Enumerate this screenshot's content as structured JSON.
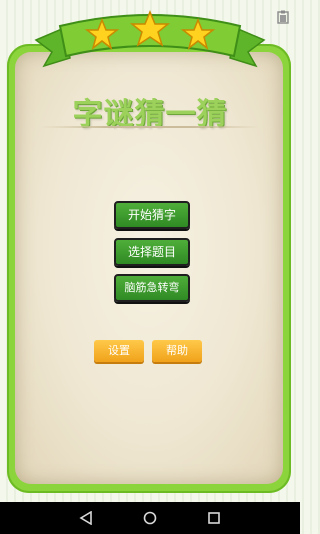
{
  "game": {
    "title": "字谜猜一猜",
    "menu": {
      "start": "开始猜字",
      "select": "选择题目",
      "riddles": "脑筋急转弯"
    },
    "settings": "设置",
    "help": "帮助",
    "stars": 3
  },
  "icons": {
    "status": "clipboard-icon",
    "nav_back": "back-triangle-icon",
    "nav_home": "home-circle-icon",
    "nav_recent": "recent-square-icon"
  },
  "colors": {
    "frame_green": "#8cd43c",
    "title_green": "#9cd25b",
    "button_green": "#3a9a2c",
    "button_orange": "#f5b02a",
    "star_yellow": "#ffd21f"
  }
}
